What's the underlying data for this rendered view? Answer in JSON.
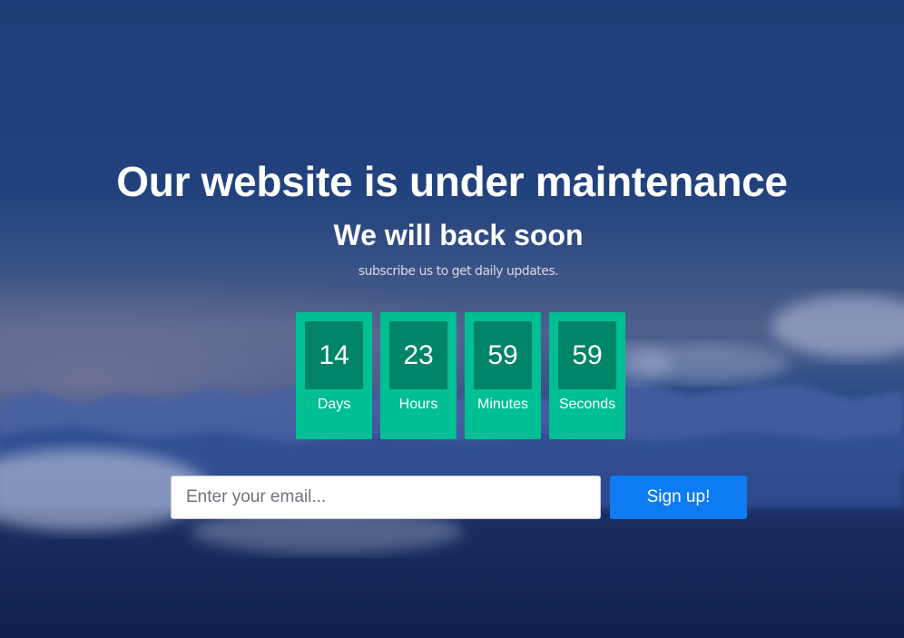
{
  "hero": {
    "title": "Our website is under maintenance",
    "subtitle": "We will back soon",
    "tagline": "subscribe us to get daily updates."
  },
  "countdown": [
    {
      "value": "14",
      "label": "Days"
    },
    {
      "value": "23",
      "label": "Hours"
    },
    {
      "value": "59",
      "label": "Minutes"
    },
    {
      "value": "59",
      "label": "Seconds"
    }
  ],
  "signup": {
    "email_placeholder": "Enter your email...",
    "email_value": "",
    "button_label": "Sign up!"
  },
  "colors": {
    "countdown_box": "#00bf94",
    "countdown_number_bg": "#008468",
    "button": "#0d7cf2"
  }
}
